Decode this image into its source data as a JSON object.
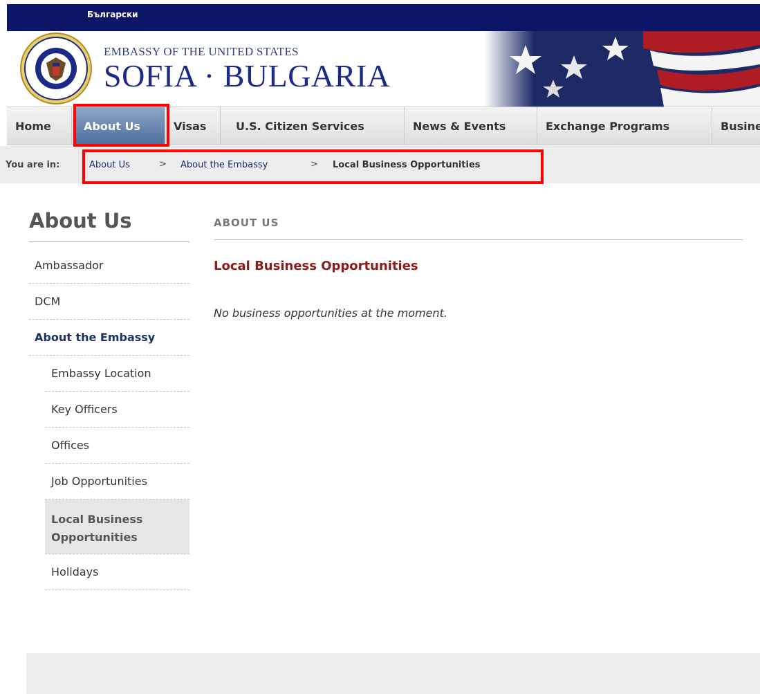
{
  "top_bar": {
    "language_link": "Български"
  },
  "header": {
    "subtitle": "EMBASSY OF THE UNITED STATES",
    "title": "SOFIA · BULGARIA",
    "seal_icon": "us-embassy-seal-icon",
    "flag_icon": "us-flag-banner-icon",
    "seal_text": "UNITED STATES OF AMERICA · EMBASSY"
  },
  "nav": {
    "items": [
      {
        "label": "Home"
      },
      {
        "label": "About Us",
        "active": true
      },
      {
        "label": "Visas"
      },
      {
        "label": "U.S. Citizen Services"
      },
      {
        "label": "News & Events"
      },
      {
        "label": "Exchange Programs"
      },
      {
        "label": "Business"
      }
    ]
  },
  "breadcrumb": {
    "prefix": "You are in:",
    "separator": ">",
    "items": [
      "About Us",
      "About the Embassy",
      "Local Business Opportunities"
    ]
  },
  "sidebar": {
    "title": "About Us",
    "items": [
      {
        "label": "Ambassador"
      },
      {
        "label": "DCM"
      },
      {
        "label": "About the Embassy",
        "selected_parent": true
      },
      {
        "label": "Embassy Location"
      },
      {
        "label": "Key Officers"
      },
      {
        "label": "Offices"
      },
      {
        "label": "Job Opportunities"
      },
      {
        "label": "Local Business Opportunities",
        "current": true
      },
      {
        "label": "Holidays"
      }
    ]
  },
  "main": {
    "section_label": "ABOUT US",
    "page_title": "Local Business Opportunities",
    "body_text": "No business opportunities at the moment."
  },
  "colors": {
    "top_bar": "#0c1566",
    "active_nav": "#4c6d9a",
    "page_title": "#8b1b1b",
    "highlight": "#ff0000"
  }
}
